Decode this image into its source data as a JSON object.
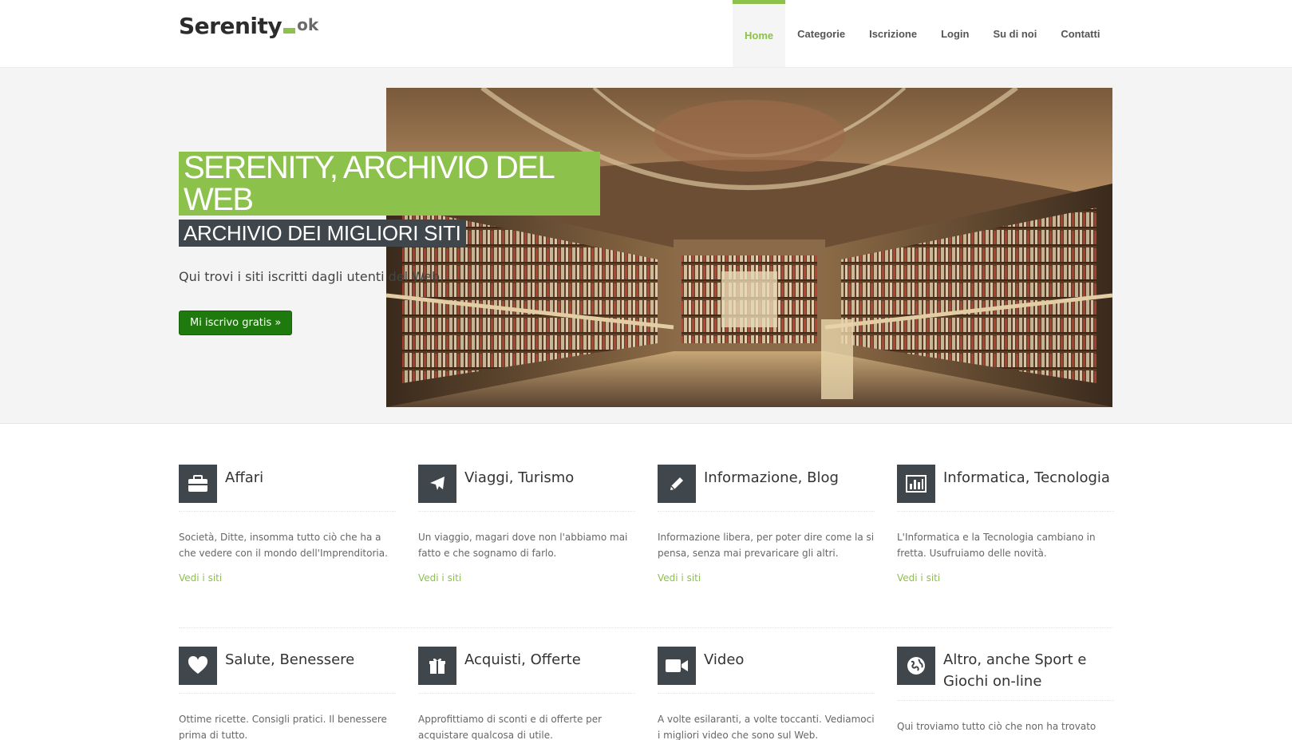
{
  "header": {
    "logo": {
      "main": "Serenity",
      "suffix": "ok"
    },
    "nav": [
      {
        "label": "Home",
        "active": true
      },
      {
        "label": "Categorie"
      },
      {
        "label": "Iscrizione"
      },
      {
        "label": "Login"
      },
      {
        "label": "Su di noi"
      },
      {
        "label": "Contatti"
      }
    ]
  },
  "hero": {
    "title": "SERENITY, ARCHIVIO DEL WEB",
    "subtitle": "ARCHIVIO DEI MIGLIORI SITI",
    "text": "Qui trovi i siti iscritti dagli utenti del Web.",
    "button": "Mi iscrivo gratis »",
    "image_alt": "library-interior"
  },
  "colors": {
    "accent": "#8cc14b",
    "dark": "#3f474d",
    "button": "#1f7a0e"
  },
  "features": [
    {
      "icon": "briefcase-icon",
      "title": "Affari",
      "desc": "Società, Ditte, insomma tutto ciò che ha a che vedere con il mondo dell'Imprenditoria.",
      "link": "Vedi i siti"
    },
    {
      "icon": "airplane-icon",
      "title": "Viaggi, Turismo",
      "desc": "Un viaggio, magari dove non l'abbiamo mai fatto e che sognamo di farlo.",
      "link": "Vedi i siti"
    },
    {
      "icon": "pencil-icon",
      "title": "Informazione, Blog",
      "desc": "Informazione libera, per poter dire come la si pensa, senza mai prevaricare gli altri.",
      "link": "Vedi i siti"
    },
    {
      "icon": "bar-chart-icon",
      "title": "Informatica, Tecnologia",
      "desc": "L'Informatica e la Tecnologia cambiano in fretta. Usufruiamo delle novità.",
      "link": "Vedi i siti"
    },
    {
      "icon": "heart-icon",
      "title": "Salute, Benessere",
      "desc": "Ottime ricette. Consigli pratici. Il benessere prima di tutto.",
      "link": ""
    },
    {
      "icon": "gift-icon",
      "title": "Acquisti, Offerte",
      "desc": "Approfittiamo di sconti e di offerte per acquistare qualcosa di utile.",
      "link": ""
    },
    {
      "icon": "video-camera-icon",
      "title": "Video",
      "desc": "A volte esilaranti, a volte toccanti. Vediamoci i migliori video che sono sul Web.",
      "link": ""
    },
    {
      "icon": "globe-icon",
      "title": "Altro, anche Sport e Giochi on-line",
      "desc": "Qui troviamo tutto ciò che non ha trovato",
      "link": ""
    }
  ]
}
